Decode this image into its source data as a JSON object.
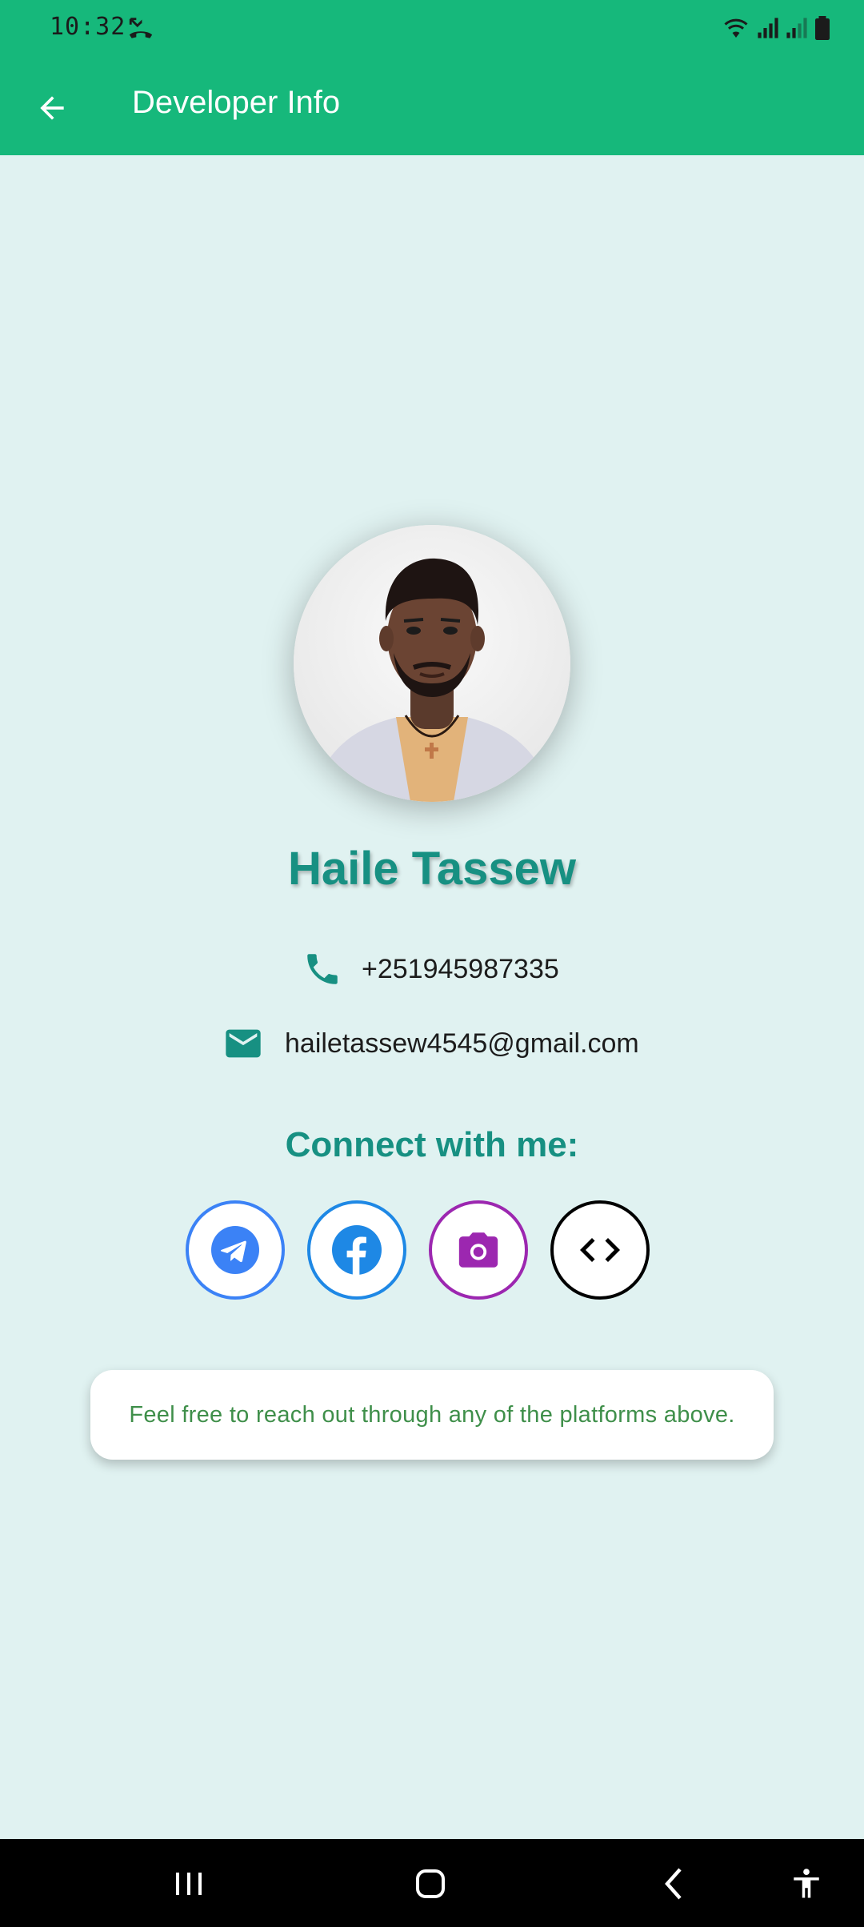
{
  "status_bar": {
    "time": "10:32"
  },
  "app_bar": {
    "title": "Developer Info"
  },
  "profile": {
    "name": "Haile Tassew",
    "phone": "+251945987335",
    "email": "hailetassew4545@gmail.com"
  },
  "connect": {
    "heading": "Connect with me:",
    "socials": [
      {
        "icon": "telegram-icon",
        "color": "#3b82f6"
      },
      {
        "icon": "facebook-icon",
        "color": "#1e88e5"
      },
      {
        "icon": "instagram-camera-icon",
        "color": "#9c27b0"
      },
      {
        "icon": "code-icon",
        "color": "#000000"
      }
    ]
  },
  "note": {
    "text": "Feel free to reach out through any of the platforms above."
  },
  "colors": {
    "primary": "#16b87b",
    "accent": "#179082",
    "background": "#e0f2f1"
  }
}
